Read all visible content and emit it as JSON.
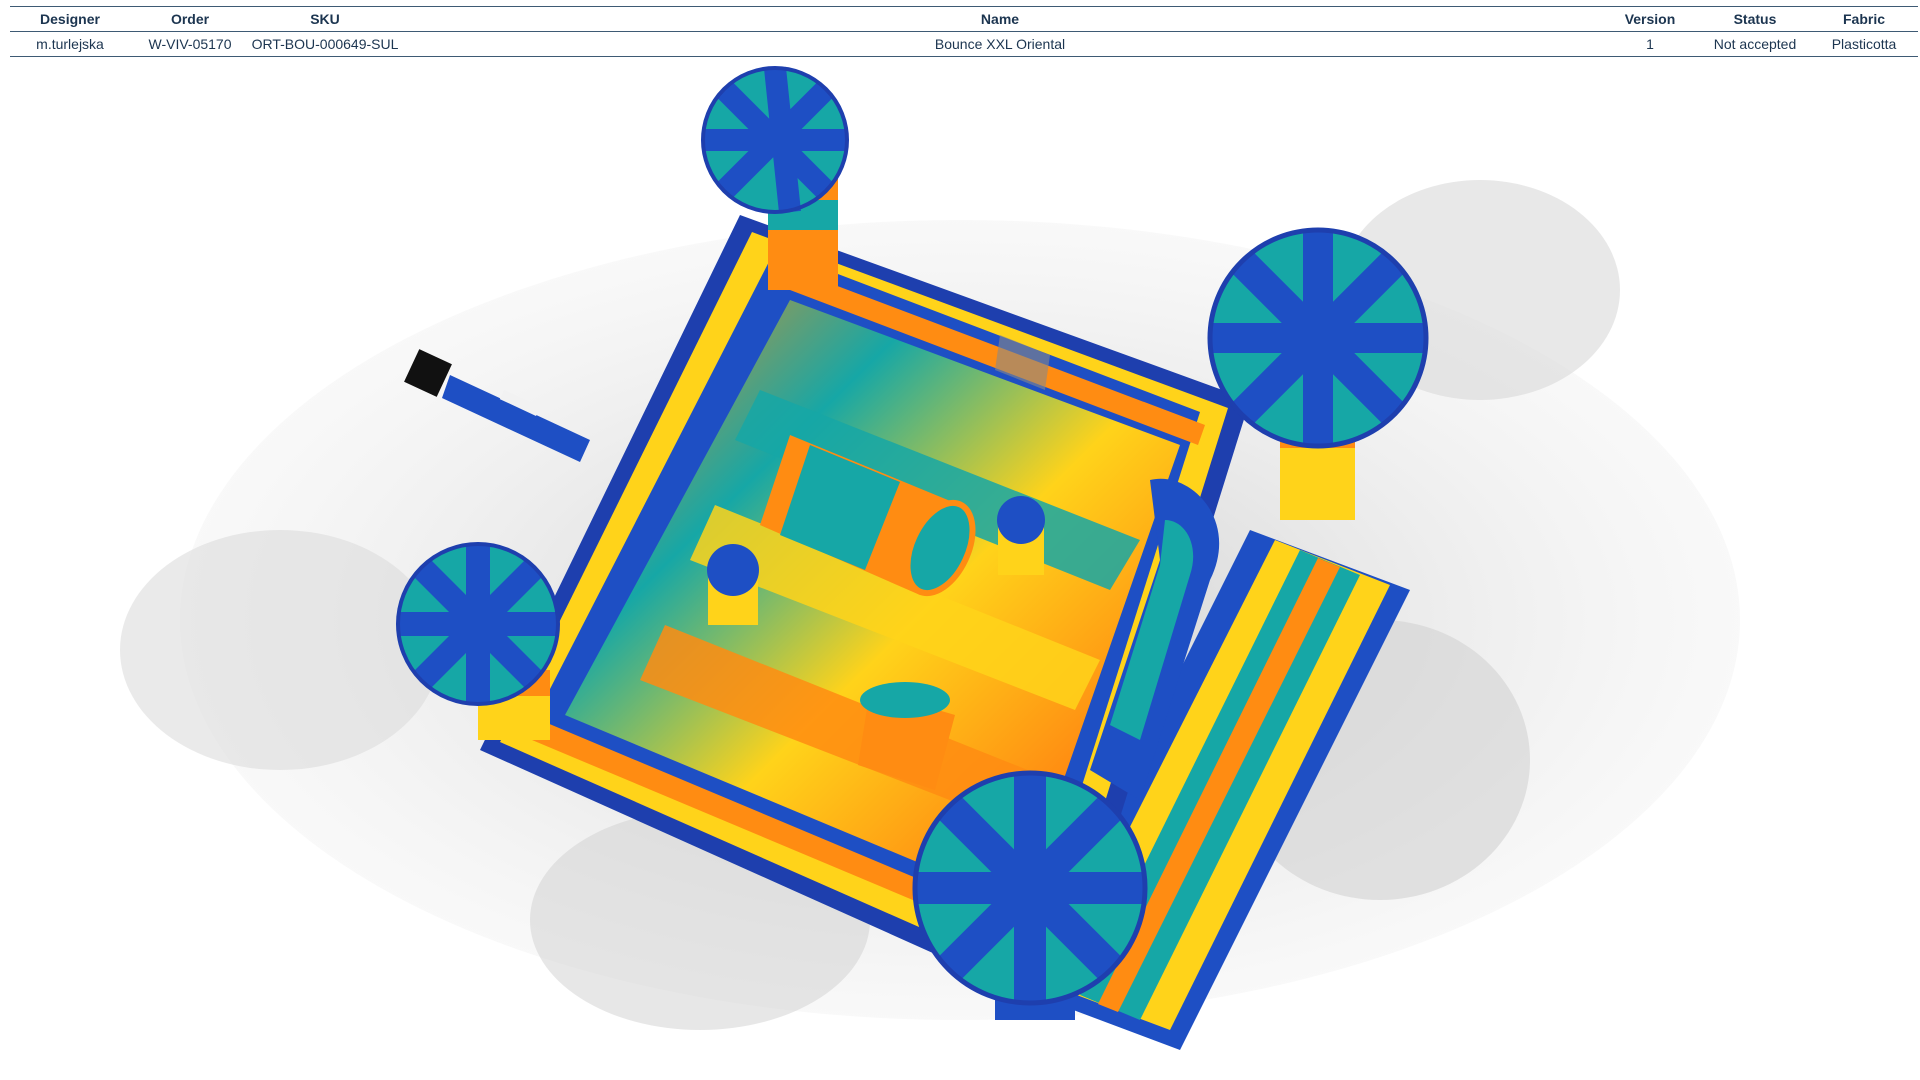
{
  "info_table": {
    "headers": [
      "Designer",
      "Order",
      "SKU",
      "Name",
      "Version",
      "Status",
      "Fabric"
    ],
    "row": [
      "m.turlejska",
      "W-VIV-05170",
      "ORT-BOU-000649-SUL",
      "Bounce XXL Oriental",
      "1",
      "Not accepted",
      "Plasticotta"
    ]
  },
  "colors": {
    "header_text": "#1c3550",
    "rule": "#3e5a74",
    "blue": "#1e4fc4",
    "teal": "#16a7a6",
    "orange": "#ff8c12",
    "yellow": "#ffd31a"
  },
  "render": {
    "icon": "inflatable-castle-3d-render"
  }
}
